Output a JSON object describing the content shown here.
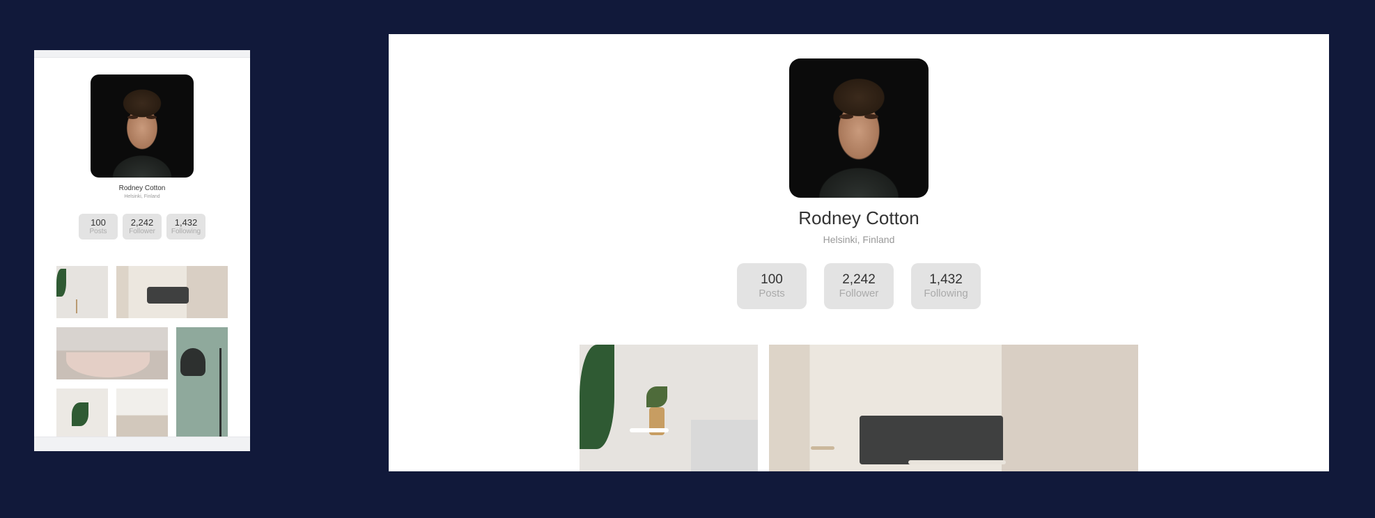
{
  "profile": {
    "name": "Rodney Cotton",
    "location": "Helsinki, Finland",
    "avatar_icon": "profile-photo"
  },
  "stats": [
    {
      "value": "100",
      "label": "Posts"
    },
    {
      "value": "2,242",
      "label": "Follower"
    },
    {
      "value": "1,432",
      "label": "Following"
    }
  ],
  "gallery": [
    {
      "icon": "living-room-plant-photo"
    },
    {
      "icon": "sofa-photo"
    },
    {
      "icon": "bathtub-photo"
    },
    {
      "icon": "floor-lamp-photo"
    },
    {
      "icon": "plant-photo"
    },
    {
      "icon": "coffee-table-photo"
    }
  ],
  "colors": {
    "background": "#11193a",
    "card": "#ffffff",
    "stat_box": "#e3e3e3"
  }
}
